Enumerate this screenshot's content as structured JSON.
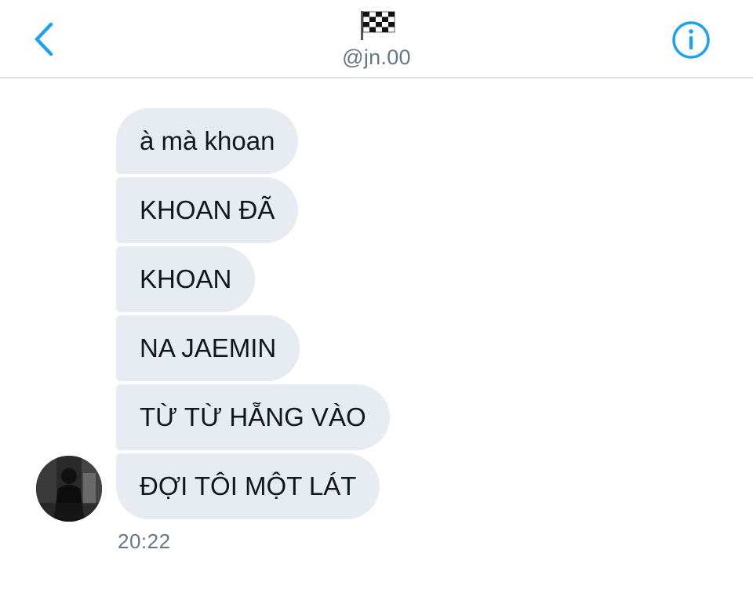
{
  "header": {
    "title_emoji": "🏁",
    "handle": "@jn.00",
    "back_icon": "chevron-left-icon",
    "info_icon": "info-circle-icon"
  },
  "colors": {
    "accent": "#1da1f2",
    "bubble_bg": "#e6ecf1",
    "text": "#14171a",
    "muted": "#657786"
  },
  "messages": [
    {
      "text": "à mà khoan"
    },
    {
      "text": "KHOAN ĐÃ"
    },
    {
      "text": "KHOAN"
    },
    {
      "text": "NA JAEMIN"
    },
    {
      "text": "TỪ TỪ HẴNG VÀO"
    },
    {
      "text": "ĐỢI TÔI MỘT LÁT"
    }
  ],
  "timestamp": "20:22"
}
